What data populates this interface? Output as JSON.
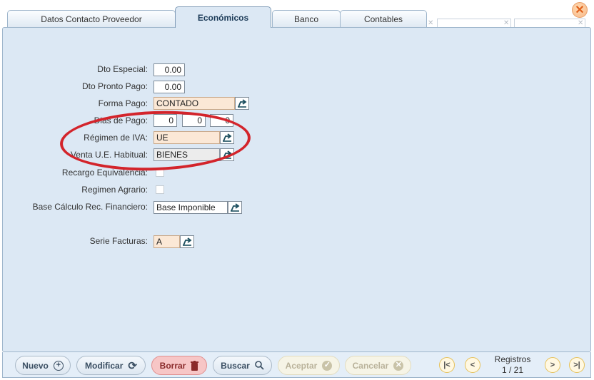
{
  "tabs": [
    {
      "label": "Datos Contacto Proveedor"
    },
    {
      "label": "Económicos"
    },
    {
      "label": "Banco"
    },
    {
      "label": "Contables"
    }
  ],
  "form": {
    "dto_especial": {
      "label": "Dto Especial:",
      "value": "0.00"
    },
    "dto_pronto_pago": {
      "label": "Dto Pronto Pago:",
      "value": "0.00"
    },
    "forma_pago": {
      "label": "Forma Pago:",
      "value": "CONTADO"
    },
    "dias_pago": {
      "label": "Dias de Pago:",
      "values": [
        "0",
        "0",
        "0"
      ]
    },
    "regimen_iva": {
      "label": "Régimen de IVA:",
      "value": "UE"
    },
    "venta_ue": {
      "label": "Venta U.E. Habitual:",
      "value": "BIENES"
    },
    "recargo": {
      "label": "Recargo Equivalencia:"
    },
    "regimen_agrario": {
      "label": "Regimen Agrario:"
    },
    "base_calculo": {
      "label": "Base Cálculo Rec. Financiero:",
      "value": "Base Imponible"
    },
    "serie_facturas": {
      "label": "Serie Facturas:",
      "value": "A"
    }
  },
  "toolbar": {
    "nuevo": "Nuevo",
    "modificar": "Modificar",
    "borrar": "Borrar",
    "buscar": "Buscar",
    "aceptar": "Aceptar",
    "cancelar": "Cancelar"
  },
  "pager": {
    "label": "Registros",
    "position": "1 / 21"
  },
  "colors": {
    "panel": "#dce8f4",
    "highlight_oval": "#d3242b",
    "danger": "#f7c6c6",
    "close": "#e0601a"
  },
  "icons": {
    "lookup": "lookup-icon",
    "close": "close-icon"
  }
}
